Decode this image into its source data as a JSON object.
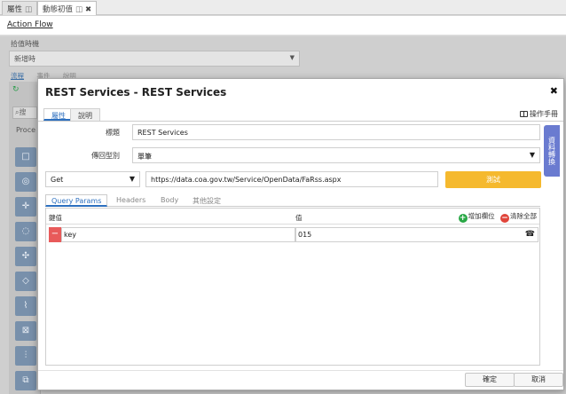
{
  "tabs": [
    {
      "label": "屬性",
      "pin": "◫"
    },
    {
      "label": "動態初值",
      "pin": "◫",
      "close": "✖"
    }
  ],
  "flow_header": {
    "title": "Action Flow"
  },
  "background": {
    "trigger_label": "拾值時機",
    "trigger_value": "新增時",
    "subtabs": [
      "流程",
      "事件",
      "說明"
    ],
    "search_placeholder": "搜",
    "proc_label": "Proce",
    "tool_icons": [
      "□",
      "◎",
      "✛",
      "◌",
      "✣",
      "◇",
      "⌇",
      "⊠",
      "⫶",
      "⧉"
    ]
  },
  "modal": {
    "title": "REST Services - REST Services",
    "close": "✖",
    "tabs": [
      {
        "label": "屬性"
      },
      {
        "label": "說明"
      }
    ],
    "manual_label": "操作手冊",
    "side_tab": "資料轉換",
    "title_label": "標題",
    "title_value": "REST Services",
    "return_type_label": "傳回型別",
    "return_type_value": "單筆",
    "method": "Get",
    "url": "https://data.coa.gov.tw/Service/OpenData/FaRss.aspx",
    "test_label": "測試",
    "param_tabs": [
      {
        "label": "Query Params"
      },
      {
        "label": "Headers"
      },
      {
        "label": "Body"
      },
      {
        "label": "其他設定"
      }
    ],
    "grid": {
      "col_key": "鍵值",
      "col_value": "值",
      "add_label": "增加欄位",
      "clear_label": "清除全部",
      "rows": [
        {
          "key": "key",
          "value": "015"
        }
      ]
    },
    "ok_label": "確定",
    "cancel_label": "取消"
  }
}
